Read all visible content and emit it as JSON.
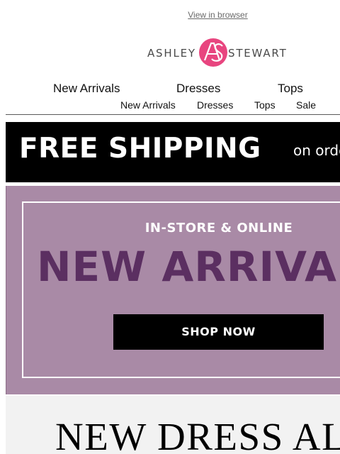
{
  "header": {
    "view_in_browser": "View in browser",
    "logo": {
      "left": "ASHLEY",
      "right": "STEWART",
      "mark_letters": "AS",
      "mark_color": "#e8457f"
    }
  },
  "nav": {
    "primary": [
      "New Arrivals",
      "Dresses",
      "Tops"
    ],
    "secondary": [
      "New Arrivals",
      "Dresses",
      "Tops",
      "Sale"
    ]
  },
  "shipping_banner": {
    "headline": "FREE SHIPPING",
    "subline": "on orders"
  },
  "hero": {
    "eyebrow": "IN-STORE & ONLINE",
    "title": "NEW ARRIVALS",
    "cta": "SHOP NOW",
    "colors": {
      "background": "#a98aa6",
      "title": "#5b2f61",
      "cta_bg": "#000000"
    }
  },
  "alert": {
    "title": "NEW DRESS ALERT"
  }
}
